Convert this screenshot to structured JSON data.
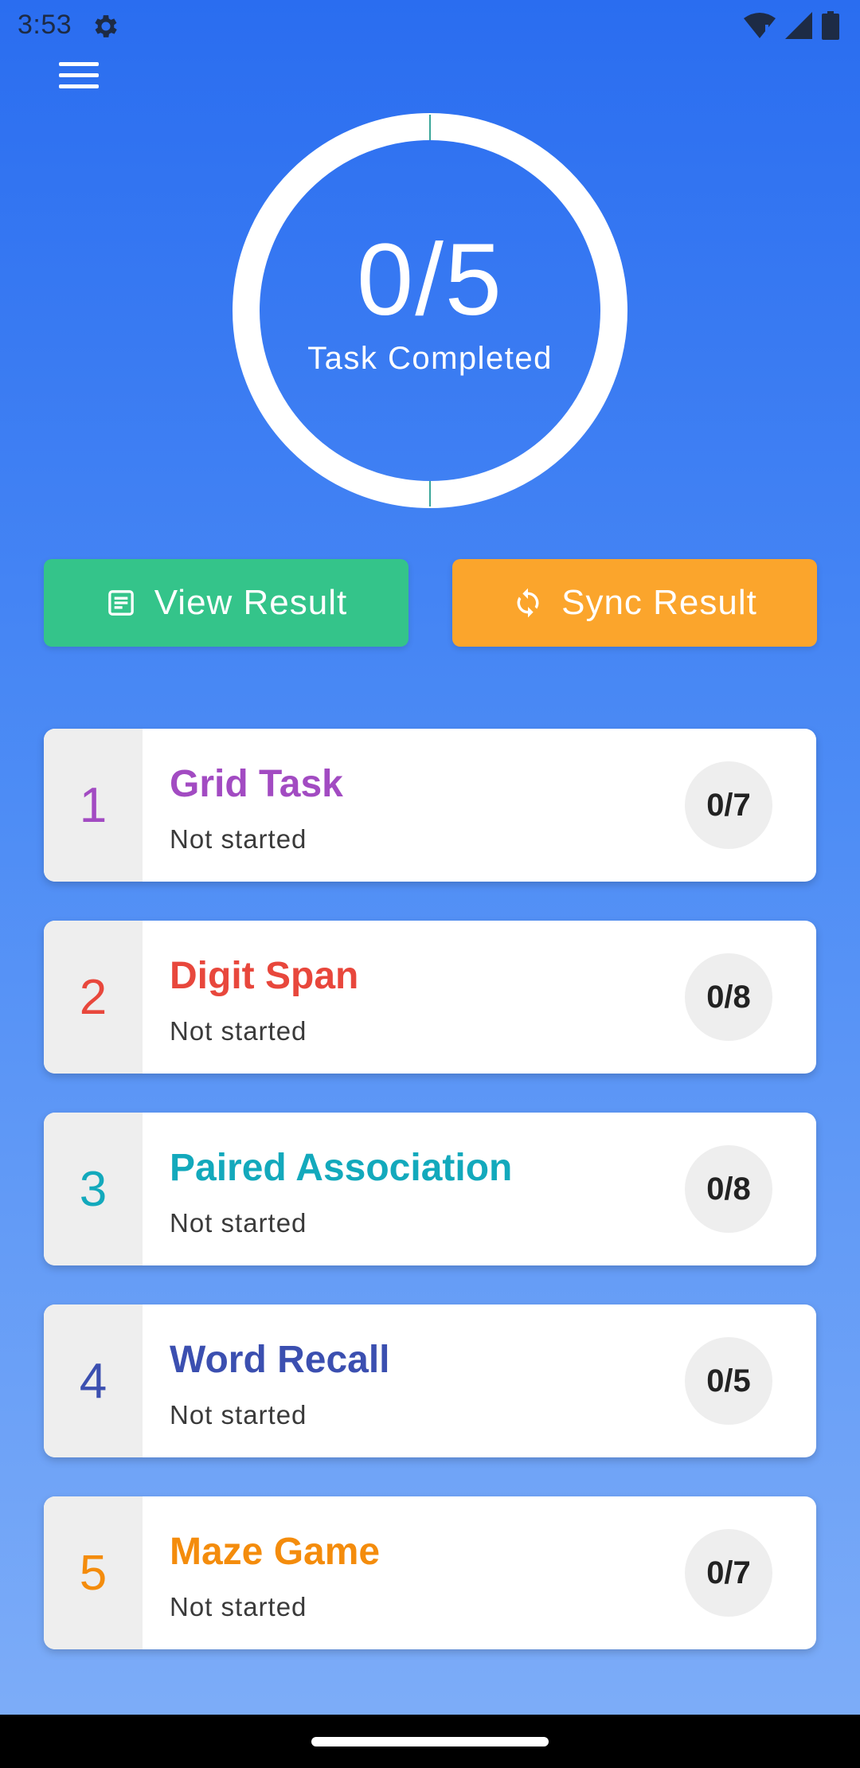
{
  "status_bar": {
    "time": "3:53",
    "icons": [
      "settings-gear-icon",
      "wifi-icon",
      "signal-icon",
      "battery-icon"
    ]
  },
  "menu": {
    "icon": "hamburger-menu-icon"
  },
  "progress": {
    "value_text": "0/5",
    "caption": "Task Completed",
    "completed": 0,
    "total": 5
  },
  "actions": {
    "view": {
      "label": "View Result",
      "icon": "document-icon",
      "color": "#34C48A"
    },
    "sync": {
      "label": "Sync Result",
      "icon": "sync-icon",
      "color": "#FBA52C"
    }
  },
  "tasks": [
    {
      "number": "1",
      "title": "Grid Task",
      "status": "Not started",
      "count": "0/7",
      "color": "#A24BC2"
    },
    {
      "number": "2",
      "title": "Digit Span",
      "status": "Not started",
      "count": "0/8",
      "color": "#E8473C"
    },
    {
      "number": "3",
      "title": "Paired Association",
      "status": "Not started",
      "count": "0/8",
      "color": "#13A9BC"
    },
    {
      "number": "4",
      "title": "Word Recall",
      "status": "Not started",
      "count": "0/5",
      "color": "#3B4FB0"
    },
    {
      "number": "5",
      "title": "Maze Game",
      "status": "Not started",
      "count": "0/7",
      "color": "#F48C0C"
    }
  ]
}
